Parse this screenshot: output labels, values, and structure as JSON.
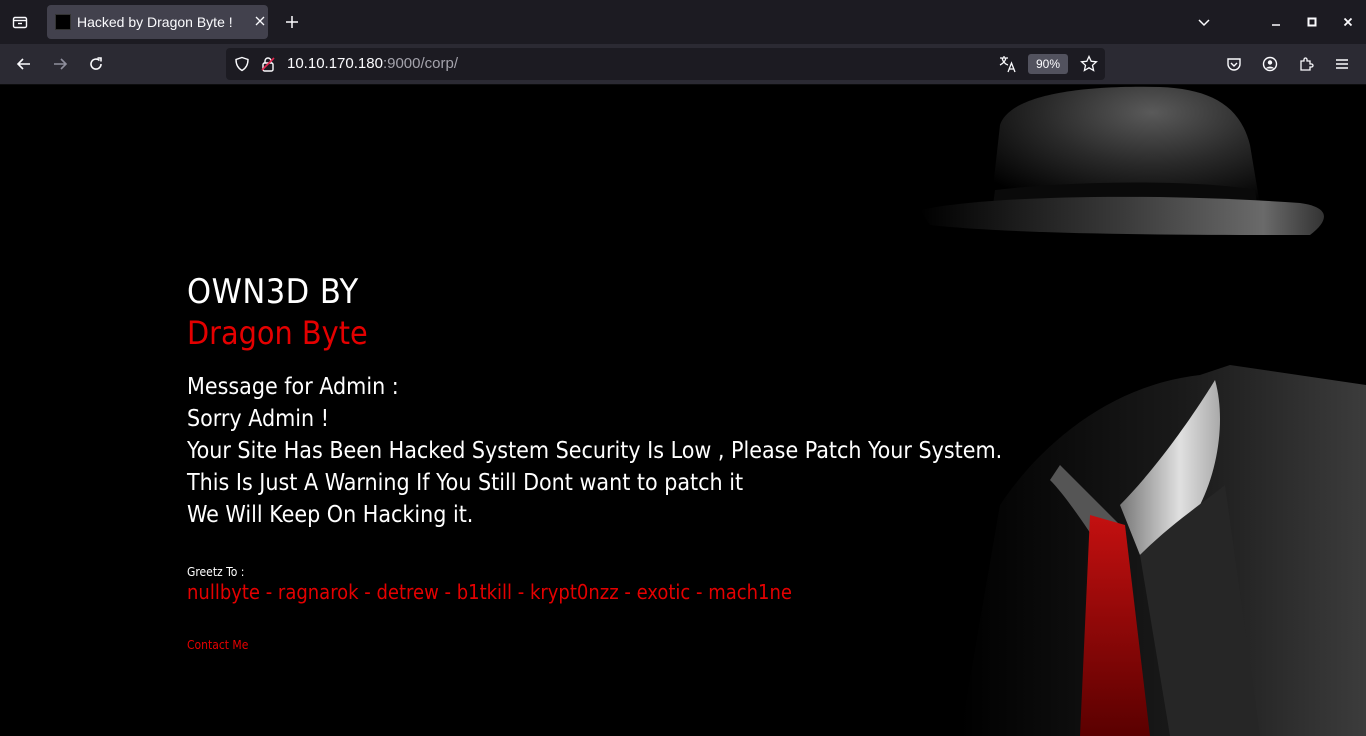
{
  "browser": {
    "tab": {
      "title": "Hacked by Dragon Byte !"
    },
    "url": {
      "host": "10.10.170.180",
      "rest": ":9000/corp/"
    },
    "zoom": "90%"
  },
  "icons": {
    "tab_list": "tab-list-icon",
    "close_tab": "close-icon",
    "new_tab": "plus-icon",
    "list_all_tabs": "chevron-down-icon",
    "back": "arrow-left-icon",
    "forward": "arrow-right-icon",
    "reload": "reload-icon",
    "tracking": "shield-icon",
    "insecure": "lock-icon",
    "translate": "translate-icon",
    "bookmark": "star-icon",
    "pocket": "pocket-icon",
    "account": "account-icon",
    "extensions": "puzzle-icon",
    "menu": "hamburger-icon"
  },
  "colors": {
    "accent_red": "#e40000",
    "page_bg": "#000000"
  },
  "page": {
    "heading": "OWN3D BY",
    "crew": "Dragon Byte",
    "message_lines": [
      "Message for Admin :",
      "Sorry Admin !",
      "Your Site Has Been Hacked System Security Is Low , Please Patch Your System.",
      "This Is Just A Warning If You Still Dont want to patch it",
      "We Will Keep On Hacking it."
    ],
    "greetz_label": "Greetz To :",
    "greetz_list": "nullbyte - ragnarok - detrew - b1tkill - krypt0nzz - exotic - mach1ne",
    "contact": "Contact Me"
  }
}
